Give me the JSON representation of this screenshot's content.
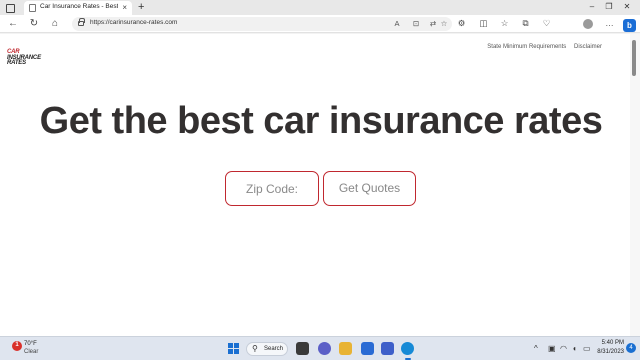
{
  "browser": {
    "tab": {
      "title": "Car Insurance Rates - Best Auto I",
      "close_glyph": "×"
    },
    "new_tab_glyph": "+",
    "window_controls": {
      "minimize": "–",
      "restore": "❐",
      "close": "✕"
    },
    "nav": {
      "back": "←",
      "refresh": "↻",
      "home": "⌂"
    },
    "url": "https://carinsurance-rates.com",
    "address_icons": {
      "read_aloud": "A",
      "immersive_reader": "⊡",
      "translate": "⇄",
      "favorite": "☆"
    },
    "toolbar": {
      "extensions": "⚙",
      "split_screen": "◫",
      "favorites": "☆",
      "collections": "⧉",
      "browser_essentials": "♡"
    },
    "more_glyph": "…",
    "bing_label": "b"
  },
  "page": {
    "logo": {
      "line1": "CAR",
      "line2": "INSURANCE",
      "line3": "RATES"
    },
    "links": [
      "State Minimum Requirements",
      "Disclaimer"
    ],
    "headline": "Get the best car insurance rates",
    "zip_placeholder": "Zip Code:",
    "quote_button": "Get Quotes"
  },
  "taskbar": {
    "weather": {
      "badge": "1",
      "temp": "70°F",
      "condition": "Clear"
    },
    "search_label": "Search",
    "tray": {
      "chevron": "^",
      "network": "◠",
      "volume": "◖",
      "battery": "▭"
    },
    "time": "5:40 PM",
    "date": "8/31/2023",
    "notification_count": "4"
  },
  "colors": {
    "brand_red": "#c0282f",
    "headline": "#333030",
    "taskbar": "#dfe5ef",
    "accent_blue": "#1a6fd1"
  },
  "icons": [
    "tab-actions-icon",
    "page-icon",
    "back-icon",
    "refresh-icon",
    "home-icon",
    "lock-icon",
    "read-aloud-icon",
    "translate-icon",
    "favorite-icon",
    "extensions-icon",
    "split-screen-icon",
    "collections-icon",
    "profile-icon",
    "more-icon",
    "bing-icon",
    "weather-icon",
    "windows-start-icon",
    "search-icon",
    "wifi-icon",
    "volume-icon",
    "battery-icon"
  ]
}
